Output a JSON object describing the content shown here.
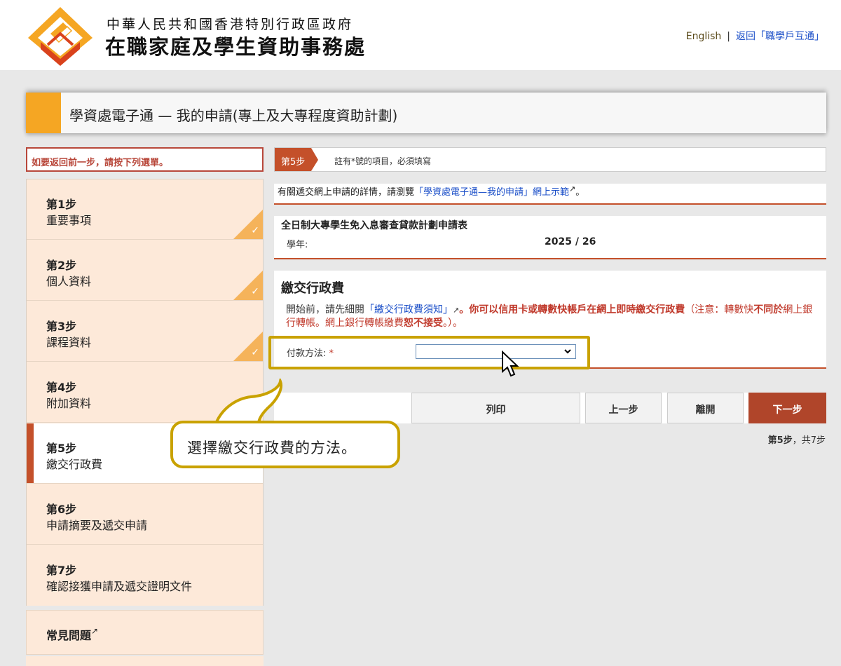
{
  "header": {
    "org_line1": "中華人民共和國香港特別行政區政府",
    "org_line2": "在職家庭及學生資助事務處",
    "english_link": "English",
    "separator": "|",
    "back_link": "返回「職學戶互通」"
  },
  "title_bar": {
    "title": "學資處電子通 — 我的申請(專上及大專程度資助計劃)"
  },
  "sidebar": {
    "back_hint": "如要返回前一步，請按下列選單。",
    "check_glyph": "✓",
    "steps": [
      {
        "num": "第1步",
        "name": "重要事項",
        "done": true
      },
      {
        "num": "第2步",
        "name": "個人資料",
        "done": true
      },
      {
        "num": "第3步",
        "name": "課程資料",
        "done": true
      },
      {
        "num": "第4步",
        "name": "附加資料",
        "done": false
      },
      {
        "num": "第5步",
        "name": "繳交行政費",
        "active": true
      },
      {
        "num": "第6步",
        "name": "申請摘要及遞交申請",
        "done": false
      },
      {
        "num": "第7步",
        "name": "確認接獲申請及遞交證明文件",
        "done": false
      }
    ],
    "faq": "常見問題",
    "external_glyph": "↗"
  },
  "stepbar": {
    "badge": "第5步",
    "note": "註有*號的項目，必須填寫"
  },
  "info": {
    "prefix": "有關遞交網上申請的詳情，請瀏覽",
    "link": "「學資處電子通—我的申請」網上示範",
    "suffix": "。"
  },
  "form": {
    "title": "全日制大專學生免入息審查貸款計劃申請表",
    "year_label": "學年:",
    "year_value": "2025 / 26"
  },
  "payment": {
    "heading": "繳交行政費",
    "desc_prefix": "開始前，請先細閱",
    "desc_link": "「繳交行政費須知」",
    "desc_bold": "。你可以信用卡或轉數快帳戶在網上即時繳交行政費",
    "desc_note1": "（注意：轉數快",
    "desc_note_bold1": "不同於",
    "desc_note2": "網上銀行轉帳。網上銀行轉帳繳費",
    "desc_note_bold2": "恕不接受",
    "desc_note3": "。）。",
    "method_label": "付款方法:",
    "required_mark": "*",
    "select_value": "",
    "chevron": "⌄"
  },
  "buttons": {
    "print": "列印",
    "prev": "上一步",
    "leave": "離開",
    "next": "下一步"
  },
  "step_count": {
    "current": "第5步",
    "comma": "，",
    "total": "共7步"
  },
  "callout": {
    "text": "選擇繳交行政費的方法。"
  },
  "colors": {
    "accent_orange": "#f5a623",
    "brand_red": "#c4502a",
    "highlight_gold": "#c9a200",
    "link_blue": "#1a4ec8"
  }
}
